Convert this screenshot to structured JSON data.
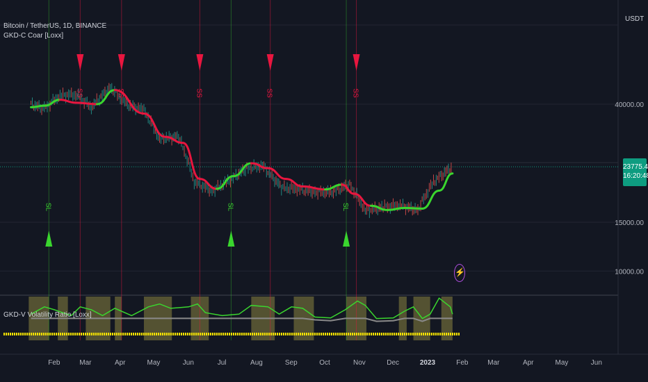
{
  "header": {
    "symbol_line": "Bitcoin / TetherUS, 1D, BINANCE",
    "indicator_main": "GKD-C Coar [Loxx]",
    "indicator_sub": "GKD-V Volatility Ratio [Loxx]",
    "currency": "USDT"
  },
  "price_axis": {
    "ticks": [
      "40000.00",
      "15000.00",
      "10000.00"
    ],
    "last_price": "23775.46",
    "countdown": "16:20:48"
  },
  "time_axis": {
    "ticks": [
      "Feb",
      "Mar",
      "Apr",
      "May",
      "Jun",
      "Jul",
      "Aug",
      "Sep",
      "Oct",
      "Nov",
      "Dec",
      "2023",
      "Feb",
      "Mar",
      "Apr",
      "May",
      "Jun"
    ]
  },
  "signals": {
    "short_label": "SS",
    "long_label": "SL"
  },
  "colors": {
    "background": "#131722",
    "bull": "#3ad62e",
    "bear": "#e8163f",
    "short_marker": "#e8163f",
    "long_marker": "#3ad62e",
    "volatility_zone": "#8a8340",
    "volatility_line": "#8a8a8a",
    "last_price_badge": "#0e9c80",
    "volatility_dots": "#f5e300"
  },
  "chart_data": [
    {
      "type": "line",
      "title": "Bitcoin / TetherUS, 1D, BINANCE",
      "ylim": [
        9000,
        60000
      ],
      "y_scale": "log",
      "x_range": [
        "2022-01-18",
        "2023-06-21"
      ],
      "price": {
        "x": [
          "2022-01-20",
          "2022-02-01",
          "2022-02-15",
          "2022-03-01",
          "2022-03-15",
          "2022-04-01",
          "2022-04-15",
          "2022-05-01",
          "2022-05-15",
          "2022-06-01",
          "2022-06-15",
          "2022-07-01",
          "2022-07-15",
          "2022-08-01",
          "2022-08-15",
          "2022-09-01",
          "2022-09-15",
          "2022-10-01",
          "2022-10-15",
          "2022-11-01",
          "2022-11-15",
          "2022-12-01",
          "2022-12-15",
          "2023-01-01",
          "2023-01-15",
          "2023-02-01"
        ],
        "y": [
          40000,
          38500,
          43000,
          43500,
          39000,
          46000,
          40000,
          38000,
          30000,
          30500,
          21000,
          19500,
          21000,
          23500,
          24000,
          20000,
          19800,
          19300,
          19200,
          20500,
          16500,
          17000,
          17300,
          16600,
          21000,
          23775
        ]
      },
      "smooth": {
        "x": [
          "2022-01-20",
          "2022-02-01",
          "2022-02-15",
          "2022-03-01",
          "2022-03-20",
          "2022-04-05",
          "2022-05-01",
          "2022-05-20",
          "2022-06-05",
          "2022-06-20",
          "2022-07-05",
          "2022-07-20",
          "2022-08-05",
          "2022-08-20",
          "2022-09-05",
          "2022-09-20",
          "2022-10-10",
          "2022-10-25",
          "2022-11-05",
          "2022-11-20",
          "2022-12-05",
          "2022-12-20",
          "2023-01-05",
          "2023-01-20",
          "2023-02-01"
        ],
        "y": [
          39000,
          39500,
          41500,
          40500,
          40000,
          45000,
          37000,
          30500,
          29000,
          21500,
          19800,
          22000,
          24500,
          23500,
          21500,
          20200,
          19700,
          20500,
          19000,
          17200,
          16600,
          16900,
          16800,
          19500,
          22500
        ],
        "trend": [
          "bear",
          "bull",
          "bull",
          "bear",
          "bear",
          "bull",
          "bear",
          "bear",
          "bear",
          "bear",
          "bear",
          "bull",
          "bull",
          "bear",
          "bear",
          "bear",
          "bear",
          "bull",
          "bear",
          "bear",
          "bull",
          "bull",
          "bull",
          "bull",
          "bull"
        ]
      },
      "signals": [
        {
          "type": "SS",
          "date": "2022-03-05"
        },
        {
          "type": "SS",
          "date": "2022-04-11"
        },
        {
          "type": "SS",
          "date": "2022-06-20"
        },
        {
          "type": "SS",
          "date": "2022-08-22"
        },
        {
          "type": "SS",
          "date": "2022-11-07"
        },
        {
          "type": "SL",
          "date": "2022-02-05"
        },
        {
          "type": "SL",
          "date": "2022-07-18"
        },
        {
          "type": "SL",
          "date": "2022-10-29"
        }
      ],
      "price_ticks": [
        40000,
        15000,
        10000
      ],
      "last_price": 23775.46
    },
    {
      "type": "area",
      "title": "GKD-V Volatility Ratio [Loxx]",
      "ylim": [
        0,
        1
      ],
      "series": [
        {
          "name": "volatility",
          "x": [
            "2022-01-20",
            "2022-02-01",
            "2022-02-10",
            "2022-02-25",
            "2022-03-05",
            "2022-03-15",
            "2022-03-25",
            "2022-04-05",
            "2022-04-20",
            "2022-05-05",
            "2022-05-15",
            "2022-05-25",
            "2022-06-10",
            "2022-06-18",
            "2022-06-25",
            "2022-07-10",
            "2022-07-25",
            "2022-08-05",
            "2022-08-20",
            "2022-08-30",
            "2022-09-10",
            "2022-09-20",
            "2022-10-01",
            "2022-10-15",
            "2022-10-28",
            "2022-11-08",
            "2022-11-15",
            "2022-11-25",
            "2022-12-10",
            "2022-12-20",
            "2022-12-28",
            "2023-01-05",
            "2023-01-12",
            "2023-01-20",
            "2023-01-30",
            "2023-02-01"
          ],
          "y": [
            0.35,
            0.6,
            0.5,
            0.3,
            0.6,
            0.5,
            0.3,
            0.55,
            0.3,
            0.6,
            0.7,
            0.55,
            0.6,
            0.7,
            0.4,
            0.3,
            0.35,
            0.65,
            0.6,
            0.35,
            0.6,
            0.55,
            0.25,
            0.22,
            0.5,
            0.8,
            0.65,
            0.2,
            0.22,
            0.45,
            0.6,
            0.2,
            0.35,
            0.9,
            0.6,
            0.35
          ]
        }
      ],
      "zones": [
        [
          "2022-01-18",
          "2022-02-05"
        ],
        [
          "2022-02-13",
          "2022-02-22"
        ],
        [
          "2022-03-10",
          "2022-04-01"
        ],
        [
          "2022-04-05",
          "2022-04-11"
        ],
        [
          "2022-05-01",
          "2022-05-26"
        ],
        [
          "2022-06-12",
          "2022-06-28"
        ],
        [
          "2022-08-05",
          "2022-08-26"
        ],
        [
          "2022-09-12",
          "2022-09-30"
        ],
        [
          "2022-10-29",
          "2022-11-16"
        ],
        [
          "2022-12-15",
          "2022-12-22"
        ],
        [
          "2022-12-28",
          "2023-01-12"
        ],
        [
          "2023-01-22",
          "2023-02-01"
        ]
      ]
    }
  ]
}
